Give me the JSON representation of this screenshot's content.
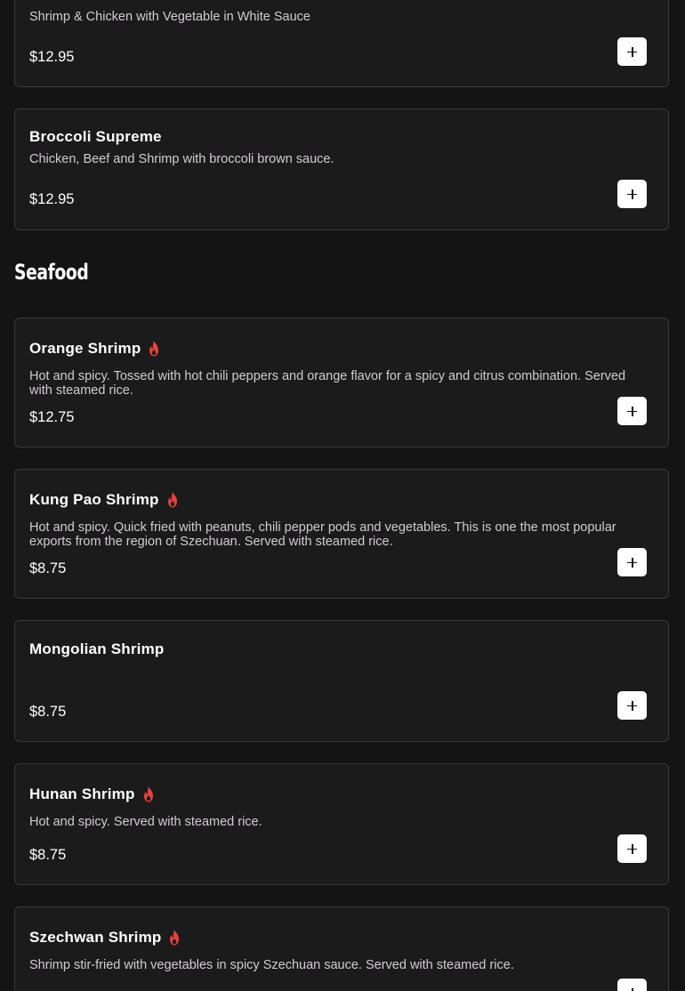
{
  "menu": {
    "spicy_icon": "flame-icon",
    "spicy_color": "#e8413b",
    "add_icon": "plus-icon",
    "items_top": [
      {
        "name": "",
        "description": "Shrimp & Chicken with Vegetable in White Sauce",
        "price": "$12.95"
      },
      {
        "name": "Broccoli Supreme",
        "description": "Chicken, Beef and Shrimp with broccoli brown sauce.",
        "price": "$12.95"
      }
    ],
    "seafood": {
      "title": "Seafood",
      "items": [
        {
          "name": "Orange Shrimp",
          "spicy": true,
          "description": "Hot and spicy. Tossed with hot chili peppers and orange flavor for a spicy and citrus combination. Served with steamed rice.",
          "price": "$12.75"
        },
        {
          "name": "Kung Pao Shrimp",
          "spicy": true,
          "description": "Hot and spicy. Quick fried with peanuts, chili pepper pods and vegetables. This is one the most popular exports from the region of Szechuan. Served with steamed rice.",
          "price": "$8.75"
        },
        {
          "name": "Mongolian Shrimp",
          "spicy": false,
          "description": "",
          "price": "$8.75"
        },
        {
          "name": "Hunan Shrimp",
          "spicy": true,
          "description": "Hot and spicy. Served with steamed rice.",
          "price": "$8.75"
        },
        {
          "name": "Szechwan Shrimp",
          "spicy": true,
          "description": "Shrimp stir-fried with vegetables in spicy Szechuan sauce. Served with steamed rice.",
          "price": ""
        }
      ]
    }
  }
}
